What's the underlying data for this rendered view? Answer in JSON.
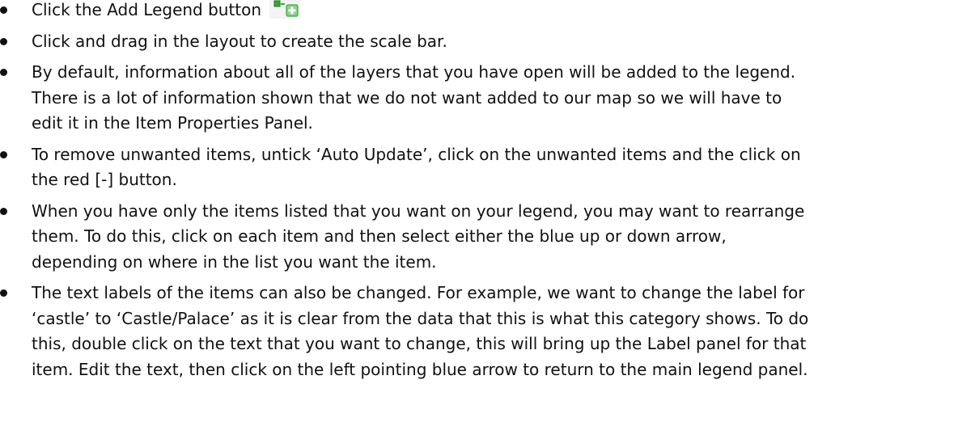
{
  "bullets": [
    {
      "lines": [
        "Click the Add Legend button"
      ],
      "has_icon": true,
      "icon": "add-legend-icon"
    },
    {
      "lines": [
        "Click and drag in the layout to create the scale bar."
      ]
    },
    {
      "lines": [
        "By default, information about all of the layers that you have open will be added to the legend.",
        "There is a lot of information shown that we do not want added to our map so we will have to",
        "edit it in the Item Properties Panel."
      ]
    },
    {
      "lines": [
        "To remove unwanted items, untick ‘Auto Update’, click on the unwanted items and the click on",
        "the red [-] button."
      ]
    },
    {
      "lines": [
        "When you have only the items listed that you want on your legend, you may want to rearrange",
        "them. To do this, click on each item and then select either the blue up or down arrow,",
        "depending on where in the list you want the item."
      ]
    },
    {
      "lines": [
        "The text labels of the items can also be changed. For example, we want to change the label for",
        "‘castle’ to ‘Castle/Palace’ as it is clear from the data that this is what this category shows. To do",
        "this, double click on the text that you want to change, this will bring up the Label panel for that",
        "item. Edit the text, then click on the left pointing blue arrow to return to the main legend panel."
      ]
    }
  ],
  "colors": {
    "text": "#111111",
    "icon_green": "#3aa63a",
    "icon_green_light": "#8fd08f"
  }
}
